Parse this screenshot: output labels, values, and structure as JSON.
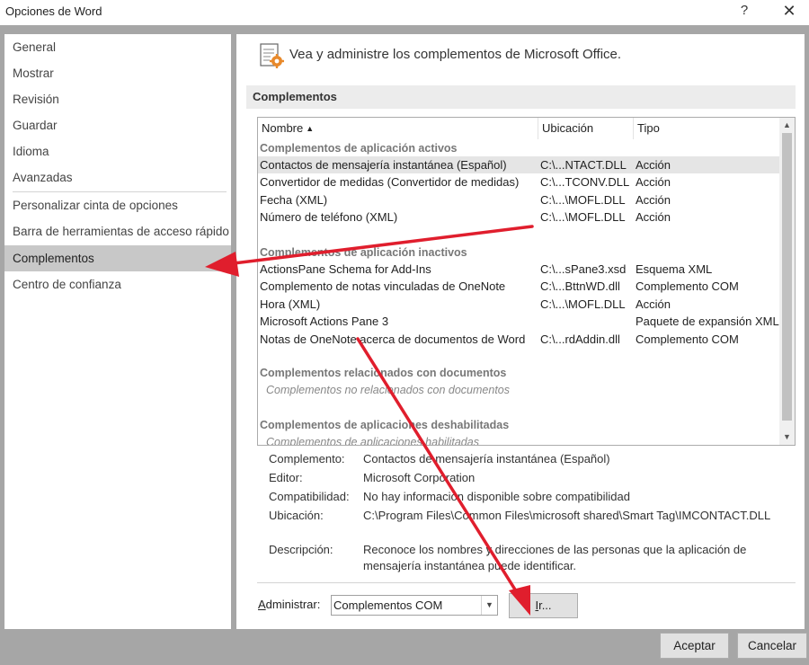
{
  "window": {
    "title": "Opciones de Word",
    "help": "?",
    "close": "✕"
  },
  "sidebar": {
    "items": [
      {
        "label": "General"
      },
      {
        "label": "Mostrar"
      },
      {
        "label": "Revisión"
      },
      {
        "label": "Guardar"
      },
      {
        "label": "Idioma"
      },
      {
        "label": "Avanzadas"
      },
      {
        "label": "Personalizar cinta de opciones"
      },
      {
        "label": "Barra de herramientas de acceso rápido"
      },
      {
        "label": "Complementos"
      },
      {
        "label": "Centro de confianza"
      }
    ],
    "selected": "Complementos"
  },
  "main": {
    "header": "Vea y administre los complementos de Microsoft Office.",
    "section_title": "Complementos",
    "columns": {
      "name": "Nombre",
      "location": "Ubicación",
      "type": "Tipo"
    },
    "groups": [
      {
        "title": "Complementos de aplicación activos",
        "rows": [
          {
            "name": "Contactos de mensajería instantánea (Español)",
            "location": "C:\\...NTACT.DLL",
            "type": "Acción"
          },
          {
            "name": "Convertidor de medidas (Convertidor de medidas)",
            "location": "C:\\...TCONV.DLL",
            "type": "Acción"
          },
          {
            "name": "Fecha (XML)",
            "location": "C:\\...\\MOFL.DLL",
            "type": "Acción"
          },
          {
            "name": "Número de teléfono (XML)",
            "location": "C:\\...\\MOFL.DLL",
            "type": "Acción"
          }
        ]
      },
      {
        "title": "Complementos de aplicación inactivos",
        "rows": [
          {
            "name": "ActionsPane Schema for Add-Ins",
            "location": "C:\\...sPane3.xsd",
            "type": "Esquema XML"
          },
          {
            "name": "Complemento de notas vinculadas de OneNote",
            "location": "C:\\...BttnWD.dll",
            "type": "Complemento COM"
          },
          {
            "name": "Hora (XML)",
            "location": "C:\\...\\MOFL.DLL",
            "type": "Acción"
          },
          {
            "name": "Microsoft Actions Pane 3",
            "location": "",
            "type": "Paquete de expansión XML"
          },
          {
            "name": "Notas de OneNote acerca de documentos de Word",
            "location": "C:\\...rdAddin.dll",
            "type": "Complemento COM"
          }
        ]
      },
      {
        "title": "Complementos relacionados con documentos",
        "empty": "Complementos no relacionados con documentos"
      },
      {
        "title": "Complementos de aplicaciones deshabilitadas",
        "empty": "Complementos de aplicaciones habilitadas"
      }
    ],
    "details": {
      "complemento_label": "Complemento:",
      "complemento_value": "Contactos de mensajería instantánea (Español)",
      "editor_label": "Editor:",
      "editor_value": "Microsoft Corporation",
      "compat_label": "Compatibilidad:",
      "compat_value": "No hay información disponible sobre compatibilidad",
      "location_label": "Ubicación:",
      "location_value": "C:\\Program Files\\Common Files\\microsoft shared\\Smart Tag\\IMCONTACT.DLL",
      "desc_label": "Descripción:",
      "desc_value": "Reconoce los nombres y direcciones de las personas que la aplicación de mensajería instantánea puede identificar."
    },
    "manage": {
      "label_prefix": "A",
      "label_rest": "dministrar:",
      "selected": "Complementos COM",
      "go_button_u": "I",
      "go_button_rest": "r..."
    }
  },
  "footer": {
    "accept": "Aceptar",
    "cancel": "Cancelar"
  },
  "colors": {
    "arrow": "#e01e2d",
    "selected_nav": "#c8c8c8",
    "frame": "#a6a6a6"
  }
}
